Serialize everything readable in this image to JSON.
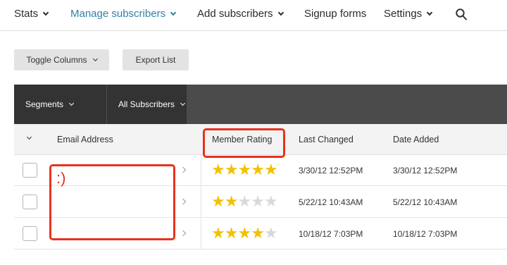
{
  "nav": {
    "items": [
      {
        "label": "Stats",
        "dropdown": true,
        "active": false
      },
      {
        "label": "Manage subscribers",
        "dropdown": true,
        "active": true
      },
      {
        "label": "Add subscribers",
        "dropdown": true,
        "active": false
      },
      {
        "label": "Signup forms",
        "dropdown": false,
        "active": false
      },
      {
        "label": "Settings",
        "dropdown": true,
        "active": false
      }
    ],
    "search_icon": "search-icon"
  },
  "toolbar": {
    "toggle_columns_label": "Toggle Columns",
    "export_list_label": "Export List"
  },
  "segments": {
    "segments_label": "Segments",
    "all_subscribers_label": "All Subscribers"
  },
  "table": {
    "columns": [
      "Email Address",
      "Member Rating",
      "Last Changed",
      "Date Added"
    ],
    "rows": [
      {
        "email": "",
        "rating": 5,
        "last_changed": "3/30/12 12:52PM",
        "date_added": "3/30/12 12:52PM"
      },
      {
        "email": "",
        "rating": 2,
        "last_changed": "5/22/12 10:43AM",
        "date_added": "5/22/12 10:43AM"
      },
      {
        "email": "",
        "rating": 4,
        "last_changed": "10/18/12 7:03PM",
        "date_added": "10/18/12 7:03PM"
      }
    ],
    "rating_max": 5
  },
  "annotation": {
    "text": ":)",
    "color": "#e8321e"
  },
  "colors": {
    "accent": "#2f7fa6",
    "star_on": "#f2c200",
    "star_off": "#d9d9d9",
    "segment_bar": "#4b4b4b",
    "segment_tab": "#333333"
  }
}
